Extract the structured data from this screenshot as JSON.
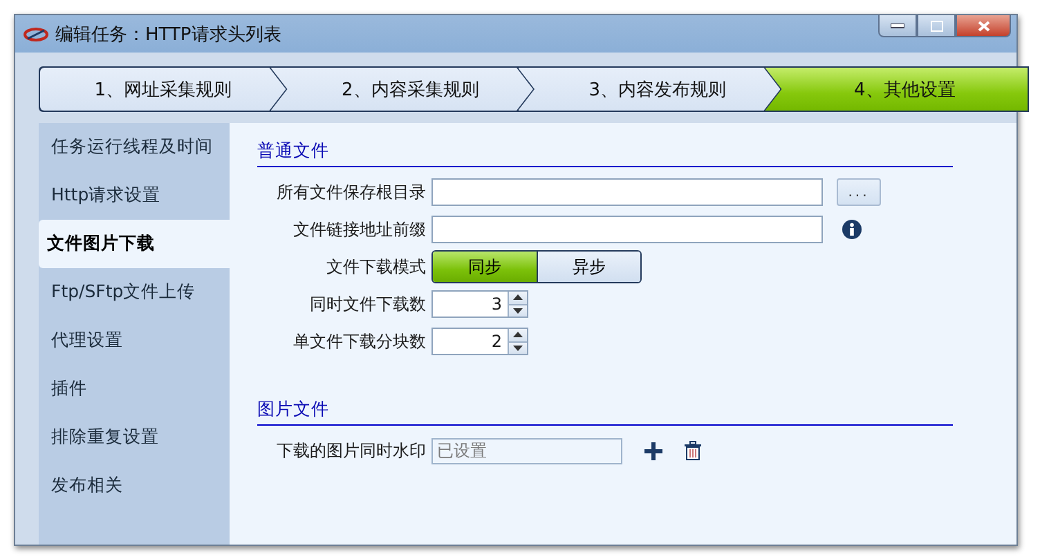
{
  "window": {
    "title": "编辑任务：HTTP请求头列表"
  },
  "steps": [
    {
      "label": "1、网址采集规则",
      "selected": false
    },
    {
      "label": "2、内容采集规则",
      "selected": false
    },
    {
      "label": "3、内容发布规则",
      "selected": false
    },
    {
      "label": "4、其他设置",
      "selected": true
    }
  ],
  "sidebar": {
    "items": [
      {
        "label": "任务运行线程及时间",
        "selected": false
      },
      {
        "label": "Http请求设置",
        "selected": false
      },
      {
        "label": "文件图片下载",
        "selected": true
      },
      {
        "label": "Ftp/SFtp文件上传",
        "selected": false
      },
      {
        "label": "代理设置",
        "selected": false
      },
      {
        "label": "插件",
        "selected": false
      },
      {
        "label": "排除重复设置",
        "selected": false
      },
      {
        "label": "发布相关",
        "selected": false
      }
    ]
  },
  "sections": [
    {
      "title": "普通文件",
      "fields": [
        {
          "kind": "text",
          "label": "所有文件保存根目录",
          "button": "..."
        },
        {
          "kind": "text",
          "label": "文件链接地址前缀",
          "info": true
        },
        {
          "kind": "toggle",
          "label": "文件下载模式",
          "options": [
            {
              "label": "同步",
              "selected": true
            },
            {
              "label": "异步",
              "selected": false
            }
          ]
        },
        {
          "kind": "spinner",
          "label": "同时文件下载数",
          "value": "3"
        },
        {
          "kind": "spinner",
          "label": "单文件下载分块数",
          "value": "2"
        }
      ]
    },
    {
      "title": "图片文件",
      "fields": [
        {
          "kind": "list",
          "label": "下载的图片同时水印",
          "value": "已设置",
          "disabled": true
        }
      ]
    }
  ]
}
